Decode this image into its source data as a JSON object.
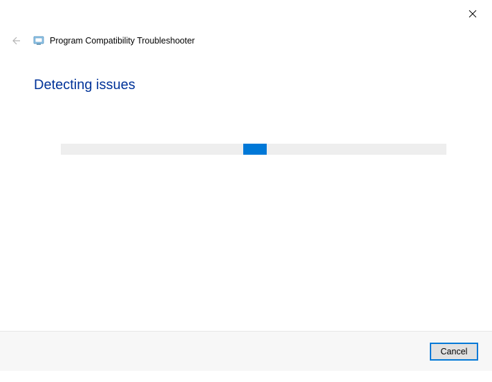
{
  "window": {
    "title": "Program Compatibility Troubleshooter"
  },
  "main": {
    "heading": "Detecting issues"
  },
  "footer": {
    "cancel_label": "Cancel"
  }
}
